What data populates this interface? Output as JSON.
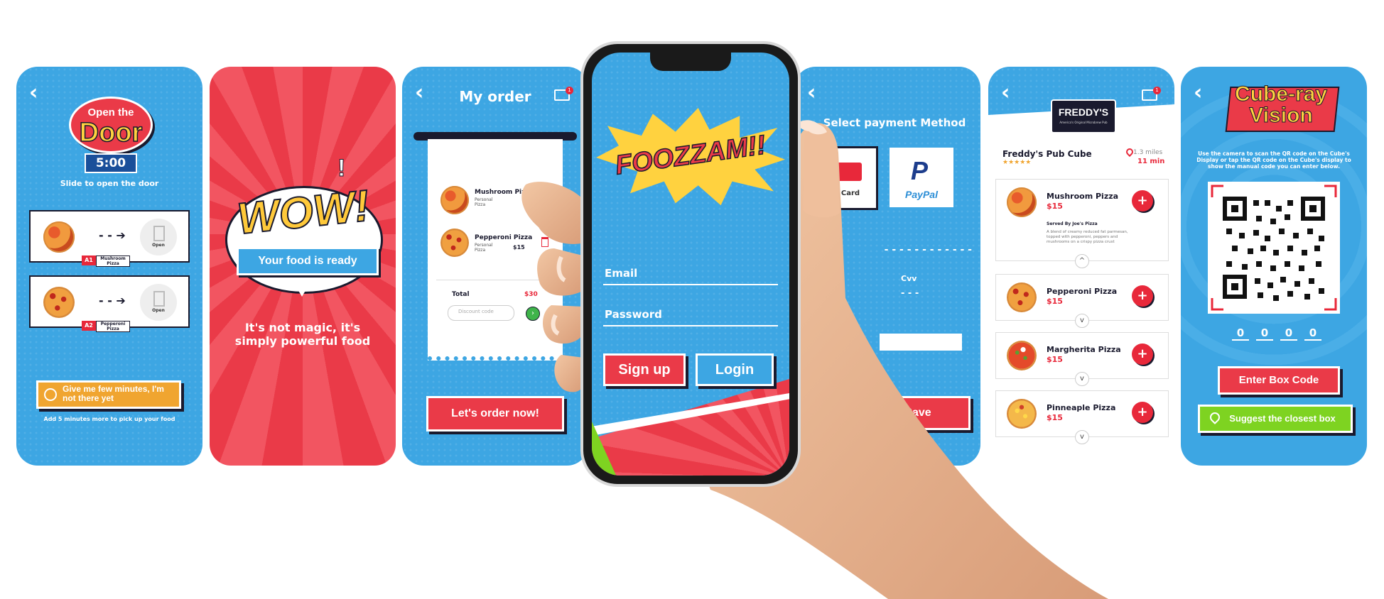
{
  "s1": {
    "back": "‹",
    "title_small": "Open the",
    "title_big": "Door",
    "timer": "5:00",
    "instruction": "Slide to open the door",
    "rows": [
      {
        "tag": "A1",
        "name": "Mushroom Pizza",
        "action": "Open",
        "arrow": "- - ➔"
      },
      {
        "tag": "A2",
        "name": "Pepperoni Pizza",
        "action": "Open",
        "arrow": "- - ➔"
      }
    ],
    "delay_button": "Give me few minutes, I'm not there yet",
    "delay_note": "Add 5 minutes more to pick up your food"
  },
  "s2": {
    "burst": "WOW!",
    "banner": "Your food is ready",
    "exclaim": "!",
    "tagline": "It's not magic, it's simply powerful food"
  },
  "s3": {
    "back": "‹",
    "title": "My order",
    "cart_count": "1",
    "items": [
      {
        "name": "Mushroom Pizza",
        "sub": "Personal Pizza",
        "price": ""
      },
      {
        "name": "Pepperoni Pizza",
        "sub": "Personal Pizza",
        "price": "$15"
      }
    ],
    "total_label": "Total",
    "total_value": "$30",
    "discount_placeholder": "Discount code",
    "order_button": "Let's order now!"
  },
  "s4": {
    "logo": "FOOZZAM!!",
    "email_placeholder": "Email",
    "password_placeholder": "Password",
    "signup": "Sign up",
    "login": "Login"
  },
  "s5": {
    "back": "‹",
    "title": "Select payment Method",
    "card_label": "Card",
    "paypal_label": "PayPal",
    "card_dashes": "- - - -   - - - -   - - - -",
    "cvv_label": "Cvv",
    "cvv_dashes": "- - -",
    "save": "Save"
  },
  "s6": {
    "back": "‹",
    "cart_count": "1",
    "logo": "FREDDY'S",
    "logo_sub": "America's Original Microbrew Pub",
    "shop_name": "Freddy's Pub Cube",
    "stars": "★★★★★",
    "distance": "1.3 miles",
    "time": "11 min",
    "items": [
      {
        "name": "Mushroom Pizza",
        "price": "$15",
        "expanded": true,
        "served_by": "Served By Joe's Pizza",
        "desc": "A blend of creamy reduced fat parmesan, topped with pepperoni, peppers and mushrooms on a crispy pizza crust",
        "chev": "^"
      },
      {
        "name": "Pepperoni Pizza",
        "price": "$15",
        "chev": "v"
      },
      {
        "name": "Margherita Pizza",
        "price": "$15",
        "chev": "v"
      },
      {
        "name": "Pinneaple Pizza",
        "price": "$15",
        "chev": "v"
      }
    ],
    "plus": "+"
  },
  "s7": {
    "back": "‹",
    "title_line1": "Cube-ray",
    "title_line2": "Vision",
    "instruction": "Use the camera to scan the QR code on the Cube's Display or tap the QR code on the Cube's display to show the manual code you can enter below.",
    "code_digits": [
      "0",
      "0",
      "0",
      "0"
    ],
    "enter_button": "Enter Box Code",
    "suggest_button": "Suggest the closest box"
  },
  "colors": {
    "blue": "#3da6e3",
    "red": "#ea3a48",
    "orange": "#f0a530",
    "green": "#7ed321",
    "yellow": "#ffd23f"
  }
}
